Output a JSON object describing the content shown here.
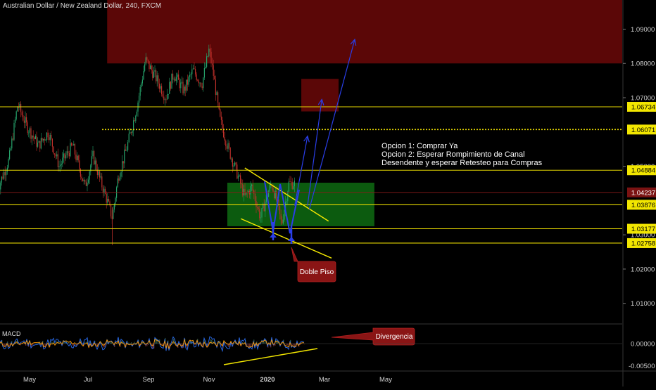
{
  "header": {
    "title": "Australian Dollar / New Zealand Dollar, 240, FXCM"
  },
  "macd_label": "MACD",
  "colors": {
    "background": "#000000",
    "level_line": "#e6d800",
    "trend_line": "#f2e600",
    "zone_red": "#7a0a0a",
    "zone_green": "#0e6b12",
    "projection": "#2a3ee8",
    "candle_up": "#26a26a",
    "candle_down": "#c0302a",
    "axis_text": "#d0d0d0",
    "macd_line": "#2a6df0",
    "signal_line": "#ff9800"
  },
  "chart_data": {
    "type": "candlestick",
    "title": "Australian Dollar / New Zealand Dollar, 240, FXCM",
    "x_tick_labels": [
      "May",
      "Jul",
      "Sep",
      "Nov",
      "2020",
      "Mar",
      "May"
    ],
    "y_tick_labels": [
      "1.09000",
      "1.08000",
      "1.07000",
      "1.05000",
      "1.03000",
      "1.02000",
      "1.01000"
    ],
    "ylim": [
      1.0042,
      1.0985
    ],
    "price_path": [
      {
        "x": "Apr 01",
        "y": 1.043
      },
      {
        "x": "Apr 12",
        "y": 1.052
      },
      {
        "x": "Apr 20",
        "y": 1.068
      },
      {
        "x": "Apr 28",
        "y": 1.062
      },
      {
        "x": "May 10",
        "y": 1.056
      },
      {
        "x": "May 20",
        "y": 1.06
      },
      {
        "x": "Jun 01",
        "y": 1.05
      },
      {
        "x": "Jun 15",
        "y": 1.056
      },
      {
        "x": "Jun 28",
        "y": 1.044
      },
      {
        "x": "Jul 06",
        "y": 1.053
      },
      {
        "x": "Jul 13",
        "y": 1.046
      },
      {
        "x": "Jul 20",
        "y": 1.04
      },
      {
        "x": "Jul 25",
        "y": 1.035
      },
      {
        "x": "Aug 01",
        "y": 1.047
      },
      {
        "x": "Aug 10",
        "y": 1.056
      },
      {
        "x": "Aug 20",
        "y": 1.068
      },
      {
        "x": "Aug 28",
        "y": 1.081
      },
      {
        "x": "Sep 08",
        "y": 1.076
      },
      {
        "x": "Sep 18",
        "y": 1.07
      },
      {
        "x": "Sep 26",
        "y": 1.077
      },
      {
        "x": "Oct 06",
        "y": 1.072
      },
      {
        "x": "Oct 15",
        "y": 1.078
      },
      {
        "x": "Oct 24",
        "y": 1.074
      },
      {
        "x": "Nov 01",
        "y": 1.084
      },
      {
        "x": "Nov 06",
        "y": 1.076
      },
      {
        "x": "Nov 12",
        "y": 1.064
      },
      {
        "x": "Nov 20",
        "y": 1.056
      },
      {
        "x": "Nov 30",
        "y": 1.048
      },
      {
        "x": "Dec 08",
        "y": 1.041
      },
      {
        "x": "Dec 15",
        "y": 1.044
      },
      {
        "x": "Dec 24",
        "y": 1.035
      },
      {
        "x": "Dec 30",
        "y": 1.041
      },
      {
        "x": "Jan 05",
        "y": 1.045
      },
      {
        "x": "Jan 10",
        "y": 1.04
      },
      {
        "x": "Jan 15",
        "y": 1.033
      },
      {
        "x": "Jan 22",
        "y": 1.045
      },
      {
        "x": "Jan 28",
        "y": 1.045
      }
    ],
    "horizontal_levels": [
      {
        "label": "1.06734",
        "value": 1.06734,
        "style": "solid"
      },
      {
        "label": "1.06071",
        "value": 1.06071,
        "style": "dotted"
      },
      {
        "label": "1.04884",
        "value": 1.04884,
        "style": "solid"
      },
      {
        "label": "1.03876",
        "value": 1.03876,
        "style": "solid"
      },
      {
        "label": "1.03177",
        "value": 1.03177,
        "style": "solid"
      },
      {
        "label": "1.02758",
        "value": 1.02758,
        "style": "solid"
      }
    ],
    "last_price": {
      "label": "1.04237",
      "value": 1.04237
    },
    "zones": [
      {
        "kind": "resistance",
        "x_from": "Jul 20",
        "x_to": "end",
        "y_from": 1.08,
        "y_to": 1.0985
      },
      {
        "kind": "resistance",
        "x_from": "Feb 05",
        "x_to": "Mar 15",
        "y_from": 1.066,
        "y_to": 1.0755
      },
      {
        "kind": "buy",
        "x_from": "Nov 20",
        "x_to": "Apr 20",
        "y_from": 1.0325,
        "y_to": 1.0452
      }
    ],
    "channel_lines": [
      {
        "from": {
          "x": "Dec 08",
          "y": 1.0495
        },
        "to": {
          "x": "Mar 05",
          "y": 1.034
        }
      },
      {
        "from": {
          "x": "Dec 04",
          "y": 1.0347
        },
        "to": {
          "x": "Mar 08",
          "y": 1.0232
        }
      }
    ],
    "projection_arrows": [
      {
        "from": {
          "x": "Jan 28",
          "y": 1.0385
        },
        "to": {
          "x": "Feb 12",
          "y": 1.0588
        }
      },
      {
        "from": {
          "x": "Feb 12",
          "y": 1.0385
        },
        "to": {
          "x": "Feb 28",
          "y": 1.0695
        }
      },
      {
        "from": {
          "x": "Feb 14",
          "y": 1.0375
        },
        "to": {
          "x": "Apr 01",
          "y": 1.087
        }
      }
    ],
    "annotations": [
      {
        "id": "options",
        "lines": [
          "Opcion 1: Comprar Ya",
          "Opcion 2: Esperar Rompimiento de Canal",
          "Desendente y esperar Retesteo para Compras"
        ]
      },
      {
        "id": "double-bottom",
        "text": "Doble Piso"
      },
      {
        "id": "divergence",
        "text": "Divergencia"
      }
    ],
    "macd": {
      "y_tick_labels": [
        "0.00000",
        "-0.00500"
      ],
      "signal_line": {
        "from": {
          "x": "Nov 10",
          "y": -0.0038
        },
        "to": {
          "x": "Feb 12",
          "y": -0.0007
        }
      }
    }
  }
}
